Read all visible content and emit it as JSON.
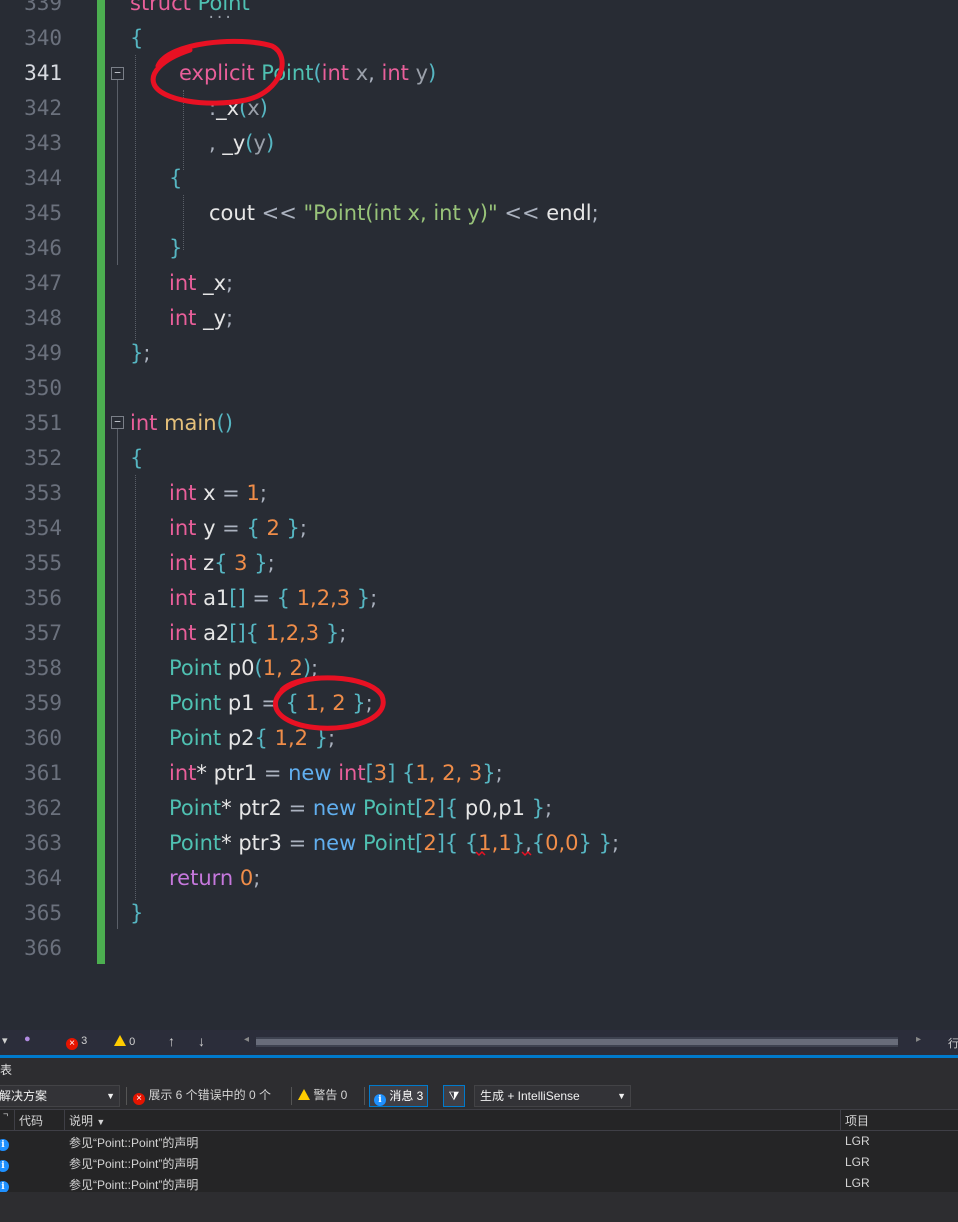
{
  "editor": {
    "lines": [
      {
        "n": "339",
        "tokens": [
          [
            "t-kw",
            "struct "
          ],
          [
            "t-type",
            "Point"
          ]
        ]
      },
      {
        "n": "340",
        "tokens": [
          [
            "t-brace",
            "{"
          ]
        ]
      },
      {
        "n": "341",
        "tokens": [
          [
            "t-kw",
            "explicit "
          ],
          [
            "t-type",
            "Point"
          ],
          [
            "t-brace",
            "("
          ],
          [
            "t-kw",
            "int "
          ],
          [
            "t-param",
            "x"
          ],
          [
            "t-punct",
            ", "
          ],
          [
            "t-kw",
            "int "
          ],
          [
            "t-param",
            "y"
          ],
          [
            "t-brace",
            ")"
          ]
        ]
      },
      {
        "n": "342",
        "tokens": [
          [
            "t-punct",
            ":"
          ],
          [
            "t-plain",
            "_x"
          ],
          [
            "t-brace",
            "("
          ],
          [
            "t-param",
            "x"
          ],
          [
            "t-brace",
            ")"
          ]
        ]
      },
      {
        "n": "343",
        "tokens": [
          [
            "t-punct",
            ", "
          ],
          [
            "t-plain",
            "_y"
          ],
          [
            "t-brace",
            "("
          ],
          [
            "t-param",
            "y"
          ],
          [
            "t-brace",
            ")"
          ]
        ]
      },
      {
        "n": "344",
        "tokens": [
          [
            "t-brace",
            "{"
          ]
        ]
      },
      {
        "n": "345",
        "tokens": [
          [
            "t-plain",
            "cout "
          ],
          [
            "t-punct",
            "<< "
          ],
          [
            "t-str",
            "\"Point(int x, int y)\""
          ],
          [
            "t-punct",
            " << "
          ],
          [
            "t-plain",
            "endl"
          ],
          [
            "t-punct",
            ";"
          ]
        ]
      },
      {
        "n": "346",
        "tokens": [
          [
            "t-brace",
            "}"
          ]
        ]
      },
      {
        "n": "347",
        "tokens": [
          [
            "t-kw",
            "int "
          ],
          [
            "t-plain",
            "_x"
          ],
          [
            "t-punct",
            ";"
          ]
        ]
      },
      {
        "n": "348",
        "tokens": [
          [
            "t-kw",
            "int "
          ],
          [
            "t-plain",
            "_y"
          ],
          [
            "t-punct",
            ";"
          ]
        ]
      },
      {
        "n": "349",
        "tokens": [
          [
            "t-brace",
            "}"
          ],
          [
            "t-punct",
            ";"
          ]
        ]
      },
      {
        "n": "350",
        "tokens": []
      },
      {
        "n": "351",
        "tokens": [
          [
            "t-kw",
            "int "
          ],
          [
            "t-fn",
            "main"
          ],
          [
            "t-brace",
            "()"
          ]
        ]
      },
      {
        "n": "352",
        "tokens": [
          [
            "t-brace",
            "{"
          ]
        ]
      },
      {
        "n": "353",
        "tokens": [
          [
            "t-kw",
            "int "
          ],
          [
            "t-plain",
            "x "
          ],
          [
            "t-punct",
            "= "
          ],
          [
            "t-num",
            "1"
          ],
          [
            "t-punct",
            ";"
          ]
        ]
      },
      {
        "n": "354",
        "tokens": [
          [
            "t-kw",
            "int "
          ],
          [
            "t-plain",
            "y "
          ],
          [
            "t-punct",
            "= "
          ],
          [
            "t-brace",
            "{ "
          ],
          [
            "t-num",
            "2"
          ],
          [
            "t-brace",
            " }"
          ],
          [
            "t-punct",
            ";"
          ]
        ]
      },
      {
        "n": "355",
        "tokens": [
          [
            "t-kw",
            "int "
          ],
          [
            "t-plain",
            "z"
          ],
          [
            "t-brace",
            "{ "
          ],
          [
            "t-num",
            "3"
          ],
          [
            "t-brace",
            " }"
          ],
          [
            "t-punct",
            ";"
          ]
        ]
      },
      {
        "n": "356",
        "tokens": [
          [
            "t-kw",
            "int "
          ],
          [
            "t-plain",
            "a1"
          ],
          [
            "t-brace",
            "[]"
          ],
          [
            "t-punct",
            " = "
          ],
          [
            "t-brace",
            "{ "
          ],
          [
            "t-num",
            "1,2,3"
          ],
          [
            "t-brace",
            " }"
          ],
          [
            "t-punct",
            ";"
          ]
        ]
      },
      {
        "n": "357",
        "tokens": [
          [
            "t-kw",
            "int "
          ],
          [
            "t-plain",
            "a2"
          ],
          [
            "t-brace",
            "[]{ "
          ],
          [
            "t-num",
            "1,2,3"
          ],
          [
            "t-brace",
            " }"
          ],
          [
            "t-punct",
            ";"
          ]
        ]
      },
      {
        "n": "358",
        "tokens": [
          [
            "t-type",
            "Point "
          ],
          [
            "t-plain",
            "p0"
          ],
          [
            "t-brace",
            "("
          ],
          [
            "t-num",
            "1, 2"
          ],
          [
            "t-brace",
            ")"
          ],
          [
            "t-punct",
            ";"
          ]
        ]
      },
      {
        "n": "359",
        "tokens": [
          [
            "t-type",
            "Point "
          ],
          [
            "t-plain",
            "p1 "
          ],
          [
            "t-punct",
            "= "
          ],
          [
            "t-brace",
            "{ "
          ],
          [
            "t-num",
            "1, 2"
          ],
          [
            "t-brace",
            " }"
          ],
          [
            "t-punct",
            ";"
          ]
        ]
      },
      {
        "n": "360",
        "tokens": [
          [
            "t-type",
            "Point "
          ],
          [
            "t-plain",
            "p2"
          ],
          [
            "t-brace",
            "{ "
          ],
          [
            "t-num",
            "1,2"
          ],
          [
            "t-brace",
            " }"
          ],
          [
            "t-punct",
            ";"
          ]
        ]
      },
      {
        "n": "361",
        "tokens": [
          [
            "t-kw",
            "int"
          ],
          [
            "t-plain",
            "* ptr1 "
          ],
          [
            "t-punct",
            "= "
          ],
          [
            "t-new",
            "new "
          ],
          [
            "t-kw",
            "int"
          ],
          [
            "t-brace",
            "["
          ],
          [
            "t-num",
            "3"
          ],
          [
            "t-brace",
            "] {"
          ],
          [
            "t-num",
            "1, 2, 3"
          ],
          [
            "t-brace",
            "}"
          ],
          [
            "t-punct",
            ";"
          ]
        ]
      },
      {
        "n": "362",
        "tokens": [
          [
            "t-type",
            "Point"
          ],
          [
            "t-plain",
            "* ptr2 "
          ],
          [
            "t-punct",
            "= "
          ],
          [
            "t-new",
            "new "
          ],
          [
            "t-type",
            "Point"
          ],
          [
            "t-brace",
            "["
          ],
          [
            "t-num",
            "2"
          ],
          [
            "t-brace",
            "]{ "
          ],
          [
            "t-plain",
            "p0,p1"
          ],
          [
            "t-brace",
            " }"
          ],
          [
            "t-punct",
            ";"
          ]
        ]
      },
      {
        "n": "363",
        "tokens": [
          [
            "t-type",
            "Point"
          ],
          [
            "t-plain",
            "* ptr3 "
          ],
          [
            "t-punct",
            "= "
          ],
          [
            "t-new",
            "new "
          ],
          [
            "t-type",
            "Point"
          ],
          [
            "t-brace",
            "["
          ],
          [
            "t-num",
            "2"
          ],
          [
            "t-brace",
            "]{ {"
          ],
          [
            "t-num",
            "1,1"
          ],
          [
            "t-brace",
            "}"
          ],
          [
            "t-punct",
            ","
          ],
          [
            "t-brace",
            "{"
          ],
          [
            "t-num",
            "0,0"
          ],
          [
            "t-brace",
            "} }"
          ],
          [
            "t-punct",
            ";"
          ]
        ]
      },
      {
        "n": "364",
        "tokens": [
          [
            "t-ret",
            "return "
          ],
          [
            "t-num",
            "0"
          ],
          [
            "t-punct",
            ";"
          ]
        ]
      },
      {
        "n": "365",
        "tokens": [
          [
            "t-brace",
            "}"
          ]
        ]
      },
      {
        "n": "366",
        "tokens": []
      }
    ]
  },
  "statusbar": {
    "error_count": "3",
    "warning_count": "0",
    "right_text": "行"
  },
  "panel": {
    "title": "表",
    "scope_combo": "解决方案",
    "errors_btn": "展示 6 个错误中的 0 个",
    "warnings_btn": "警告 0",
    "messages_btn": "消息 3",
    "source_combo": "生成 + IntelliSense",
    "columns": {
      "code": "代码",
      "desc": "说明",
      "project": "项目"
    },
    "rows": [
      {
        "desc": "参见“Point::Point”的声明",
        "project": "LGR"
      },
      {
        "desc": "参见“Point::Point”的声明",
        "project": "LGR"
      },
      {
        "desc": "参见“Point::Point”的声明",
        "project": "LGR"
      }
    ]
  },
  "colors": {
    "editor_bg": "#282c34",
    "modified_bar": "#4caf50",
    "accent": "#007acc",
    "annotation_red": "#e81123"
  }
}
